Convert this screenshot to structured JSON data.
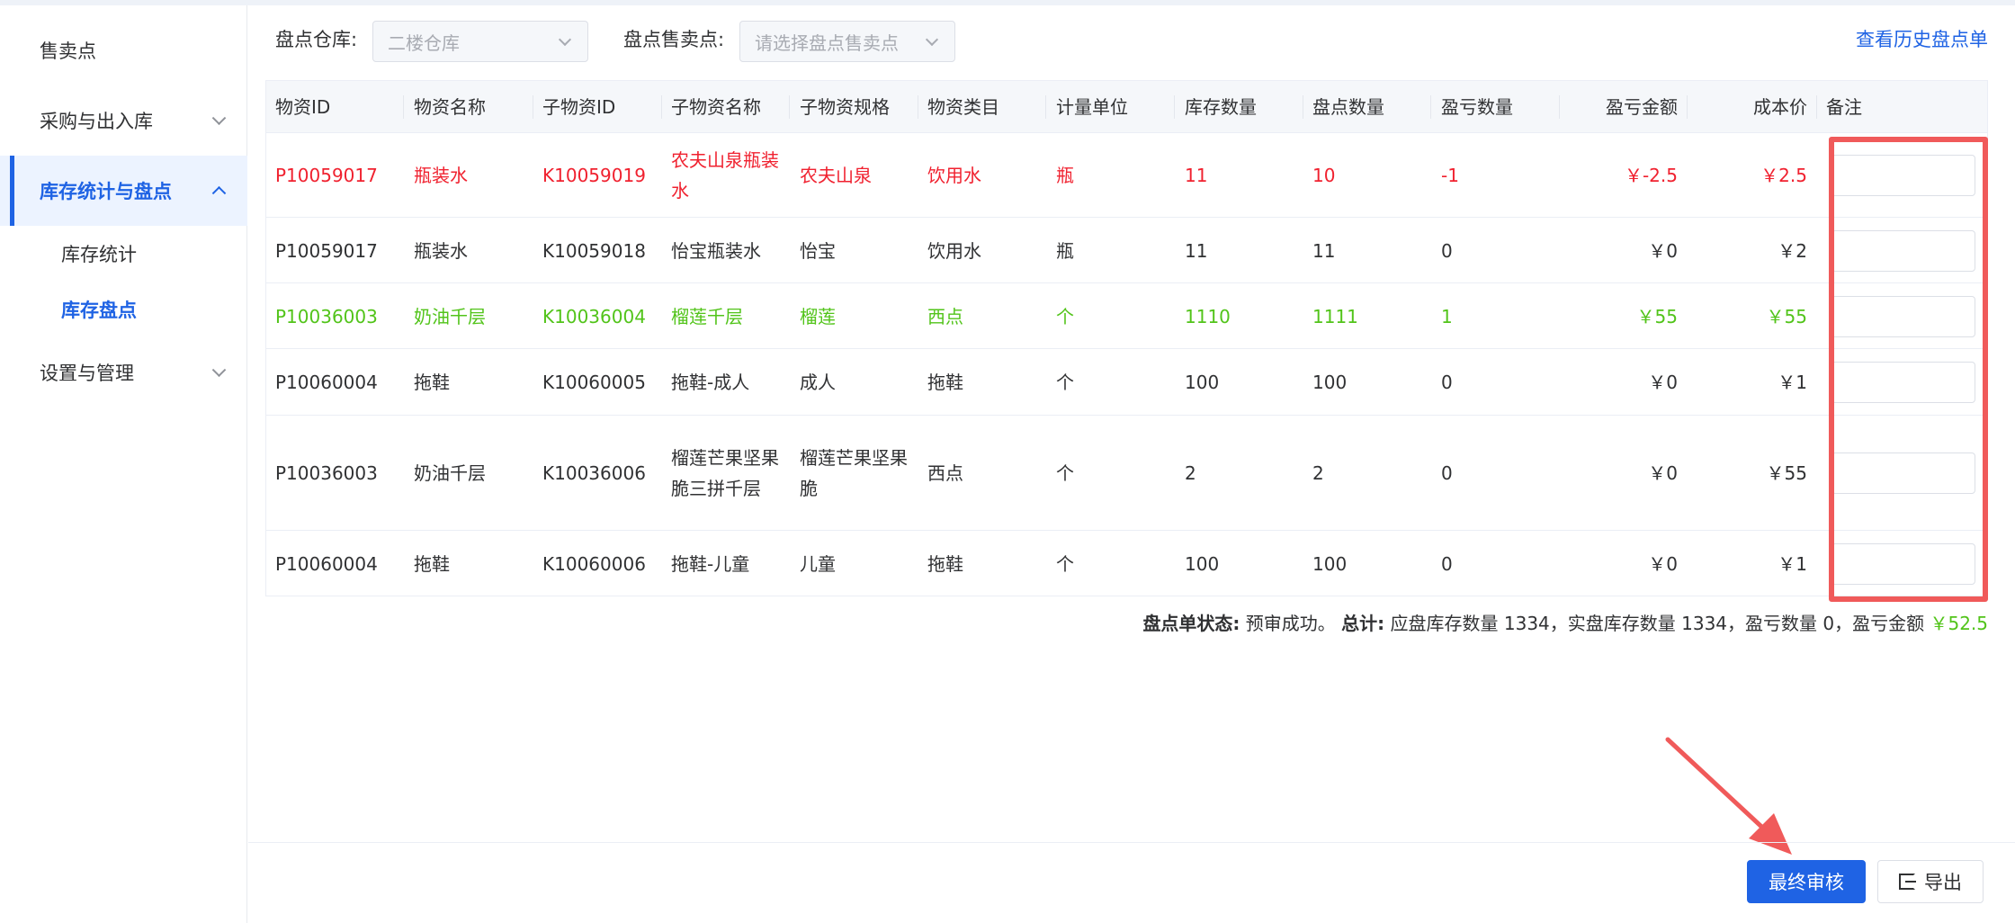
{
  "sidebar": {
    "items": [
      {
        "label": "售卖点"
      },
      {
        "label": "采购与出入库"
      },
      {
        "label": "库存统计与盘点"
      },
      {
        "label": "设置与管理"
      }
    ],
    "sub_items": [
      {
        "label": "库存统计"
      },
      {
        "label": "库存盘点"
      }
    ]
  },
  "filters": {
    "warehouse_label": "盘点仓库:",
    "warehouse_value": "二楼仓库",
    "point_label": "盘点售卖点:",
    "point_placeholder": "请选择盘点售卖点",
    "history_link": "查看历史盘点单"
  },
  "table": {
    "columns": [
      "物资ID",
      "物资名称",
      "子物资ID",
      "子物资名称",
      "子物资规格",
      "物资类目",
      "计量单位",
      "库存数量",
      "盘点数量",
      "盈亏数量",
      "盈亏金额",
      "成本价",
      "备注"
    ],
    "rows": [
      {
        "status": "loss",
        "cells": [
          "P10059017",
          "瓶装水",
          "K10059019",
          "农夫山泉瓶装水",
          "农夫山泉",
          "饮用水",
          "瓶",
          "11",
          "10",
          "-1",
          "￥-2.5",
          "￥2.5"
        ]
      },
      {
        "status": "normal",
        "cells": [
          "P10059017",
          "瓶装水",
          "K10059018",
          "怡宝瓶装水",
          "怡宝",
          "饮用水",
          "瓶",
          "11",
          "11",
          "0",
          "￥0",
          "￥2"
        ]
      },
      {
        "status": "gain",
        "cells": [
          "P10036003",
          "奶油千层",
          "K10036004",
          "榴莲千层",
          "榴莲",
          "西点",
          "个",
          "1110",
          "1111",
          "1",
          "￥55",
          "￥55"
        ]
      },
      {
        "status": "normal",
        "cells": [
          "P10060004",
          "拖鞋",
          "K10060005",
          "拖鞋-成人",
          "成人",
          "拖鞋",
          "个",
          "100",
          "100",
          "0",
          "￥0",
          "￥1"
        ]
      },
      {
        "status": "normal",
        "cells": [
          "P10036003",
          "奶油千层",
          "K10036006",
          "榴莲芒果坚果脆三拼千层",
          "榴莲芒果坚果脆",
          "西点",
          "个",
          "2",
          "2",
          "0",
          "￥0",
          "￥55"
        ]
      },
      {
        "status": "normal",
        "cells": [
          "P10060004",
          "拖鞋",
          "K10060006",
          "拖鞋-儿童",
          "儿童",
          "拖鞋",
          "个",
          "100",
          "100",
          "0",
          "￥0",
          "￥1"
        ]
      }
    ]
  },
  "summary": {
    "status_label": "盘点单状态:",
    "status_value": "预审成功。",
    "total_label": "总计:",
    "total_text": "应盘库存数量 1334，实盘库存数量 1334，盈亏数量 0，盈亏金额 ",
    "amount": "￥52.5"
  },
  "footer": {
    "final_review_label": "最终审核",
    "export_label": "导出"
  },
  "colors": {
    "accent": "#1f63e4",
    "loss": "#f0212f",
    "gain": "#52c41a",
    "annotation": "#f05a5a"
  }
}
